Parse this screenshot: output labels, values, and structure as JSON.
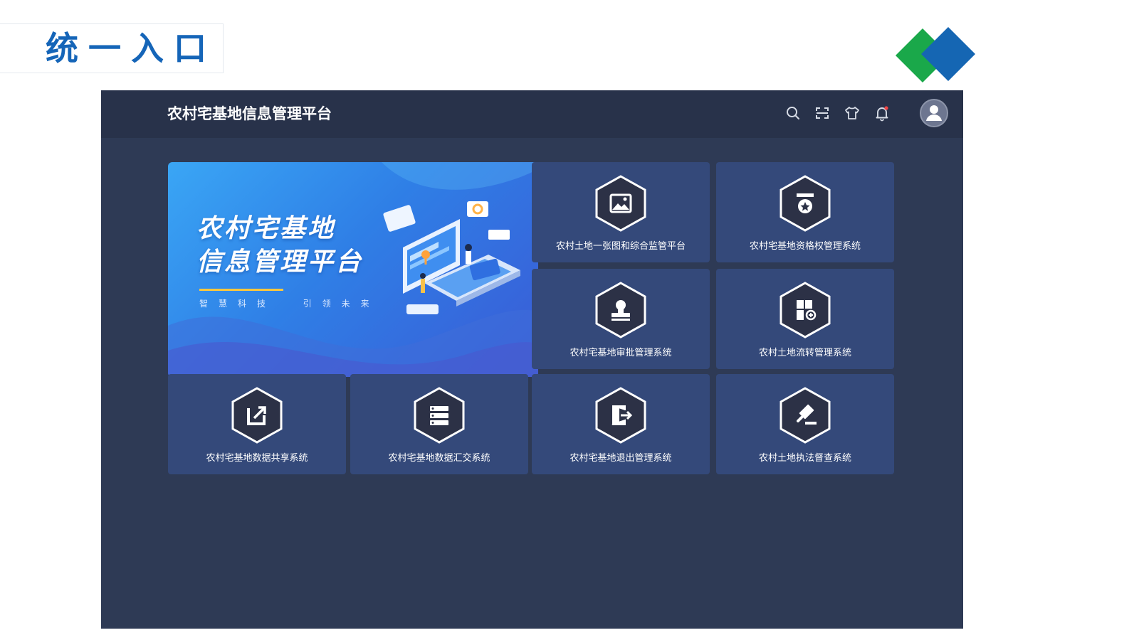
{
  "slide": {
    "title": "统一入口"
  },
  "app": {
    "title": "农村宅基地信息管理平台",
    "toolbar_icons": [
      "search-icon",
      "fullscreen-icon",
      "shirt-icon",
      "bell-icon"
    ],
    "avatar_icon": "user-avatar-icon"
  },
  "banner": {
    "title_line1": "农村宅基地",
    "title_line2": "信息管理平台",
    "slogan": "智慧科技  引领未来"
  },
  "tiles": [
    {
      "label": "农村土地一张图和综合监管平台",
      "icon": "picture-icon"
    },
    {
      "label": "农村宅基地资格权管理系统",
      "icon": "medal-icon"
    },
    {
      "label": "农村宅基地审批管理系统",
      "icon": "stamp-icon"
    },
    {
      "label": "农村土地流转管理系统",
      "icon": "blocks-transfer-icon"
    },
    {
      "label": "农村宅基地数据共享系统",
      "icon": "share-export-icon"
    },
    {
      "label": "农村宅基地数据汇交系统",
      "icon": "database-icon"
    },
    {
      "label": "农村宅基地退出管理系统",
      "icon": "exit-door-icon"
    },
    {
      "label": "农村土地执法督查系统",
      "icon": "gavel-icon"
    }
  ],
  "colors": {
    "slide_title": "#1565b8",
    "logo_green": "#1aa84a",
    "logo_blue": "#1566b3",
    "app_background": "#2e3a55",
    "topbar": "#28324a",
    "tile": "#34497a",
    "banner_accent": "#ffc83d"
  }
}
